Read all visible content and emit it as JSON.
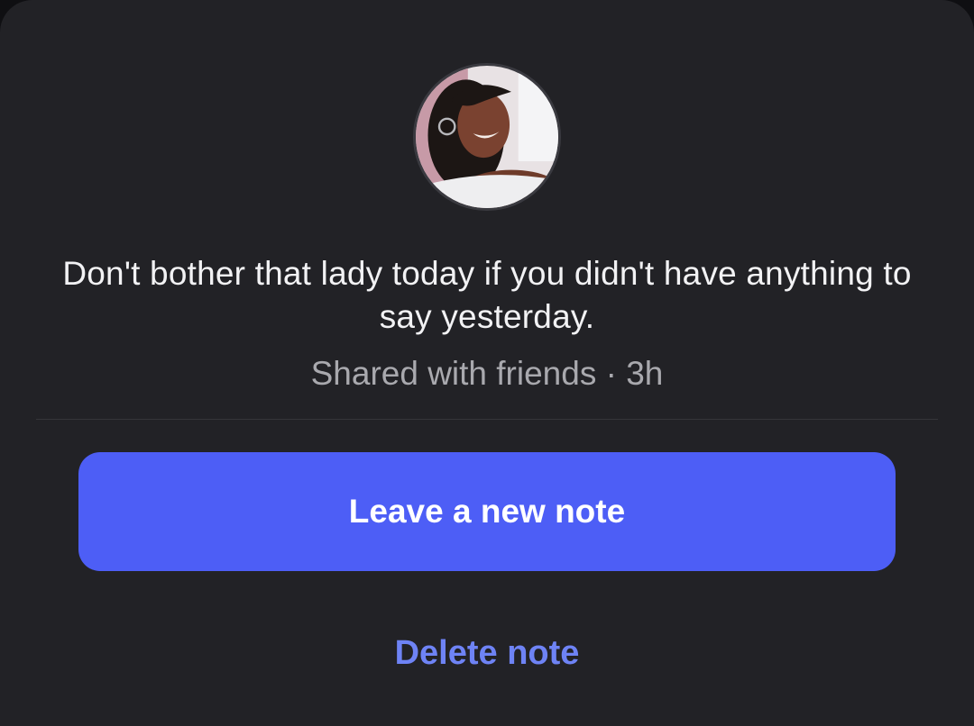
{
  "note": {
    "text": "Don't bother that lady today if you didn't have anything to say yesterday.",
    "meta": "Shared with friends · 3h"
  },
  "actions": {
    "primary_label": "Leave a new note",
    "delete_label": "Delete note"
  },
  "colors": {
    "background": "#222226",
    "primary_button": "#4d5ef6",
    "delete_link": "#6e83f5",
    "meta_text": "#a9a9ae"
  },
  "icons": {
    "avatar": "profile-photo"
  }
}
